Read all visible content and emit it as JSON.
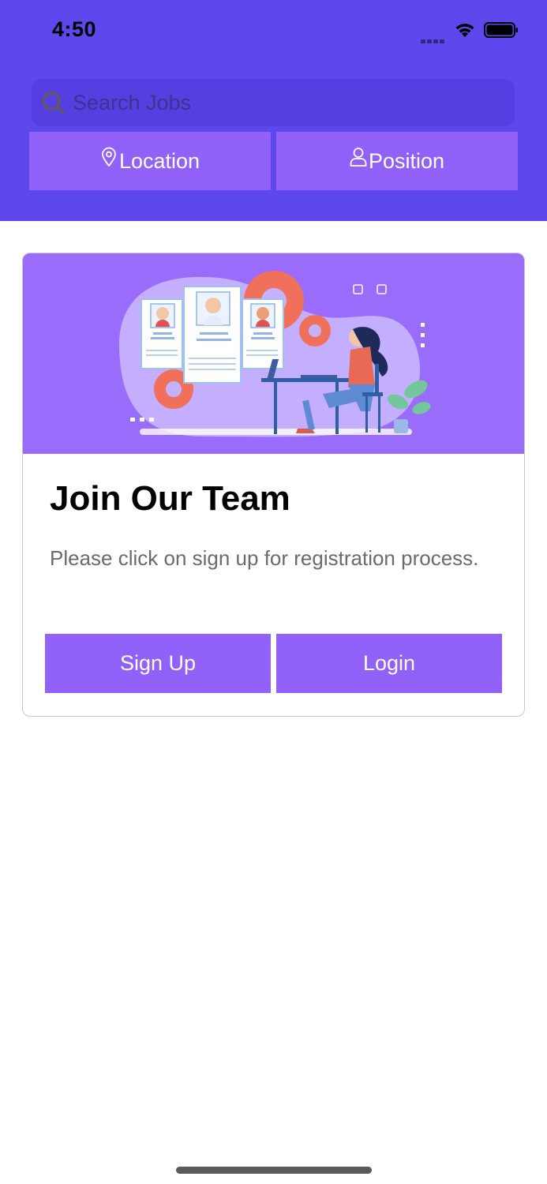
{
  "status_bar": {
    "time": "4:50"
  },
  "header": {
    "background_color": "#5c48ed",
    "search": {
      "placeholder": "Search Jobs",
      "value": ""
    },
    "filters": [
      {
        "label": "Location",
        "icon": "map-pin-icon"
      },
      {
        "label": "Position",
        "icon": "person-icon"
      }
    ]
  },
  "card": {
    "hero_illustration": "recruitment-illustration",
    "title": "Join Our Team",
    "description": "Please click on sign up for registration process.",
    "buttons": {
      "signup_label": "Sign Up",
      "login_label": "Login"
    },
    "accent_color": "#9161fa"
  }
}
